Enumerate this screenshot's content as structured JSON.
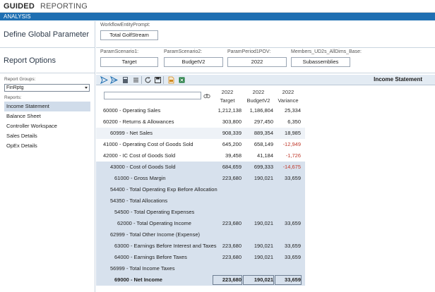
{
  "titlebar": {
    "app_strong": "GUIDED",
    "app_light": "REPORTING"
  },
  "strip": {
    "label": "ANALYSIS"
  },
  "left": {
    "global_param_title": "Define Global Parameter",
    "report_options_title": "Report Options"
  },
  "global_param": {
    "label": "WorkflowEntityPrompt:",
    "value": "Total GolfStream"
  },
  "params": [
    {
      "label": "ParamScenario1:",
      "value": "Target"
    },
    {
      "label": "ParamScenario2:",
      "value": "BudgetV2"
    },
    {
      "label": "ParamPeriod1POV:",
      "value": "2022"
    },
    {
      "label": "Members_UD2s_AllDims_Base:",
      "value": "Subassemblies"
    }
  ],
  "reports_panel": {
    "groups_label": "Report Groups:",
    "group_value": "FinRptg",
    "reports_label": "Reports:",
    "items": [
      "Income Statement",
      "Balance Sheet",
      "Controller Workspace",
      "Sales Details",
      "OpEx Details"
    ],
    "selected": "Income Statement"
  },
  "toolbar": {
    "title": "Income Statement",
    "icons": [
      "send-icon",
      "send-alt-icon",
      "calculator-icon",
      "list-icon",
      "refresh-icon",
      "save-icon",
      "export-pdf-icon",
      "export-excel-icon"
    ]
  },
  "grid": {
    "headers": [
      {
        "year": "2022",
        "name": "Target"
      },
      {
        "year": "2022",
        "name": "BudgetV2"
      },
      {
        "year": "2022",
        "name": "Variance"
      }
    ],
    "rows": [
      {
        "label": "60000 - Operating Sales",
        "indent": 0,
        "target": "1,212,138",
        "budget": "1,186,804",
        "variance": "25,334",
        "neg": false,
        "shade": "none",
        "bold": false
      },
      {
        "label": "60200 - Returns & Allowances",
        "indent": 0,
        "target": "303,800",
        "budget": "297,450",
        "variance": "6,350",
        "neg": false,
        "shade": "none",
        "bold": false
      },
      {
        "label": "60999 - Net Sales",
        "indent": 1,
        "target": "908,339",
        "budget": "889,354",
        "variance": "18,985",
        "neg": false,
        "shade": "a",
        "bold": false
      },
      {
        "label": "41000 - Operating Cost of Goods Sold",
        "indent": 0,
        "target": "645,200",
        "budget": "658,149",
        "variance": "-12,949",
        "neg": true,
        "shade": "none",
        "bold": false
      },
      {
        "label": "42000 - IC Cost of Goods Sold",
        "indent": 0,
        "target": "39,458",
        "budget": "41,184",
        "variance": "-1,726",
        "neg": true,
        "shade": "none",
        "bold": false
      },
      {
        "label": "43000 - Cost of Goods Sold",
        "indent": 1,
        "target": "684,659",
        "budget": "699,333",
        "variance": "-14,675",
        "neg": true,
        "shade": "b",
        "bold": false
      },
      {
        "label": "61000 - Gross Margin",
        "indent": 2,
        "target": "223,680",
        "budget": "190,021",
        "variance": "33,659",
        "neg": false,
        "shade": "b",
        "bold": false
      },
      {
        "label": "54400 - Total Operating Exp Before Allocation",
        "indent": 1,
        "target": "",
        "budget": "",
        "variance": "",
        "neg": false,
        "shade": "b",
        "bold": false
      },
      {
        "label": "54350 - Total Allocations",
        "indent": 1,
        "target": "",
        "budget": "",
        "variance": "",
        "neg": false,
        "shade": "b",
        "bold": false
      },
      {
        "label": "54500 - Total Operating Expenses",
        "indent": 2,
        "target": "",
        "budget": "",
        "variance": "",
        "neg": false,
        "shade": "b",
        "bold": false
      },
      {
        "label": "62000 - Total Operating Income",
        "indent": 3,
        "target": "223,680",
        "budget": "190,021",
        "variance": "33,659",
        "neg": false,
        "shade": "b",
        "bold": false
      },
      {
        "label": "62999 - Total Other Income (Expense)",
        "indent": 1,
        "target": "",
        "budget": "",
        "variance": "",
        "neg": false,
        "shade": "b",
        "bold": false
      },
      {
        "label": "63000 - Earnings Before Interest and Taxes",
        "indent": 2,
        "target": "223,680",
        "budget": "190,021",
        "variance": "33,659",
        "neg": false,
        "shade": "b",
        "bold": false
      },
      {
        "label": "64000 - Earnings Before Taxes",
        "indent": 2,
        "target": "223,680",
        "budget": "190,021",
        "variance": "33,659",
        "neg": false,
        "shade": "b",
        "bold": false
      },
      {
        "label": "56999 - Total Income Taxes",
        "indent": 1,
        "target": "",
        "budget": "",
        "variance": "",
        "neg": false,
        "shade": "b",
        "bold": false
      },
      {
        "label": "69000 - Net Income",
        "indent": 2,
        "target": "223,680",
        "budget": "190,021",
        "variance": "33,659",
        "neg": false,
        "shade": "c",
        "bold": true
      }
    ]
  }
}
